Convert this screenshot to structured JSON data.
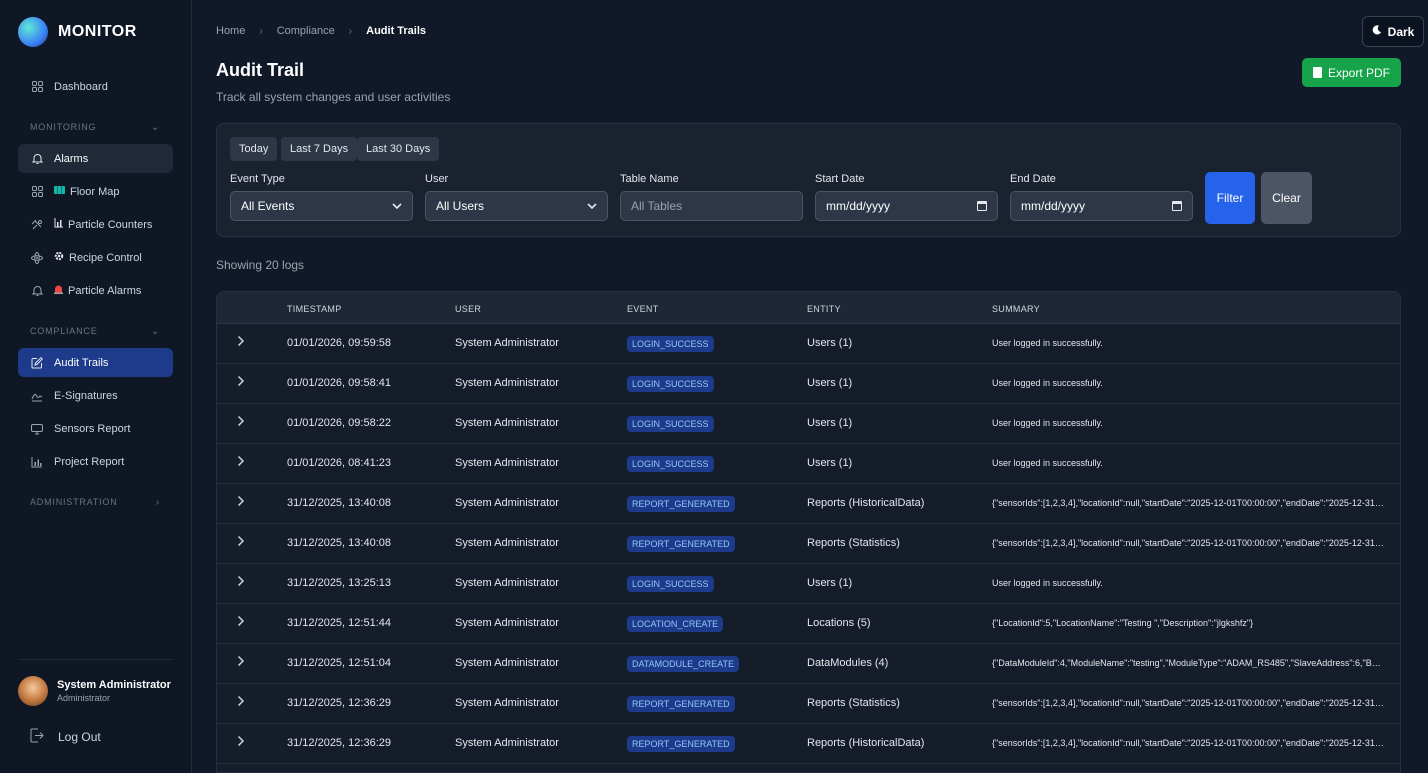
{
  "sidebar": {
    "brand": "MONITOR",
    "items": {
      "dashboard": "Dashboard",
      "alarms": "Alarms",
      "floor_map": "Floor Map",
      "particle_counters": "Particle Counters",
      "recipe_control": "Recipe Control",
      "particle_alarms": "Particle Alarms",
      "audit_trails": "Audit Trails",
      "e_signatures": "E-Signatures",
      "sensors_report": "Sensors Report",
      "project_report": "Project Report"
    },
    "sections": {
      "monitoring": "MONITORING",
      "compliance": "COMPLIANCE",
      "administration": "ADMINISTRATION"
    },
    "icons": {
      "dashboard": "grid-icon",
      "alarms": "bell-icon",
      "floor_map": "map-icon",
      "particle_counters": "chart-icon",
      "recipe_control": "gear-icon",
      "particle_alarms": "siren-icon",
      "audit_trails": "edit-icon",
      "e_signatures": "signature-icon",
      "sensors_report": "sensor-icon",
      "project_report": "bar-chart-icon"
    },
    "user": {
      "name": "System Administrator",
      "role": "Administrator"
    },
    "logout": "Log Out"
  },
  "breadcrumb": {
    "home": "Home",
    "compliance": "Compliance",
    "current": "Audit Trails"
  },
  "theme_toggle": "Dark",
  "page": {
    "title": "Audit Trail",
    "subtitle": "Track all system changes and user activities"
  },
  "export_label": "Export PDF",
  "filters": {
    "quick": [
      "Today",
      "Last 7 Days",
      "Last 30 Days"
    ],
    "event_type": {
      "label": "Event Type",
      "value": "All Events"
    },
    "user": {
      "label": "User",
      "value": "All Users"
    },
    "table_name": {
      "label": "Table Name",
      "placeholder": "All Tables"
    },
    "start_date": {
      "label": "Start Date",
      "value": "mm/dd/yyyy"
    },
    "end_date": {
      "label": "End Date",
      "value": "mm/dd/yyyy"
    },
    "filter_label": "Filter",
    "clear_label": "Clear"
  },
  "showing": "Showing 20 logs",
  "table": {
    "columns": [
      "TIMESTAMP",
      "USER",
      "EVENT",
      "ENTITY",
      "SUMMARY"
    ],
    "rows": [
      {
        "timestamp": "01/01/2026, 09:59:58",
        "user": "System Administrator",
        "event": "LOGIN_SUCCESS",
        "entity": "Users (1)",
        "summary": "User logged in successfully."
      },
      {
        "timestamp": "01/01/2026, 09:58:41",
        "user": "System Administrator",
        "event": "LOGIN_SUCCESS",
        "entity": "Users (1)",
        "summary": "User logged in successfully."
      },
      {
        "timestamp": "01/01/2026, 09:58:22",
        "user": "System Administrator",
        "event": "LOGIN_SUCCESS",
        "entity": "Users (1)",
        "summary": "User logged in successfully."
      },
      {
        "timestamp": "01/01/2026, 08:41:23",
        "user": "System Administrator",
        "event": "LOGIN_SUCCESS",
        "entity": "Users (1)",
        "summary": "User logged in successfully."
      },
      {
        "timestamp": "31/12/2025, 13:40:08",
        "user": "System Administrator",
        "event": "REPORT_GENERATED",
        "entity": "Reports (HistoricalData)",
        "summary": "{\"sensorIds\":[1,2,3,4],\"locationId\":null,\"startDate\":\"2025-12-01T00:00:00\",\"endDate\":\"2025-12-31T..."
      },
      {
        "timestamp": "31/12/2025, 13:40:08",
        "user": "System Administrator",
        "event": "REPORT_GENERATED",
        "entity": "Reports (Statistics)",
        "summary": "{\"sensorIds\":[1,2,3,4],\"locationId\":null,\"startDate\":\"2025-12-01T00:00:00\",\"endDate\":\"2025-12-31T..."
      },
      {
        "timestamp": "31/12/2025, 13:25:13",
        "user": "System Administrator",
        "event": "LOGIN_SUCCESS",
        "entity": "Users (1)",
        "summary": "User logged in successfully."
      },
      {
        "timestamp": "31/12/2025, 12:51:44",
        "user": "System Administrator",
        "event": "LOCATION_CREATE",
        "entity": "Locations (5)",
        "summary": "{\"LocationId\":5,\"LocationName\":\"Testing \",\"Description\":\"jlgkshfz\"}"
      },
      {
        "timestamp": "31/12/2025, 12:51:04",
        "user": "System Administrator",
        "event": "DATAMODULE_CREATE",
        "entity": "DataModules (4)",
        "summary": "{\"DataModuleId\":4,\"ModuleName\":\"testing\",\"ModuleType\":\"ADAM_RS485\",\"SlaveAddress\":6,\"Bas..."
      },
      {
        "timestamp": "31/12/2025, 12:36:29",
        "user": "System Administrator",
        "event": "REPORT_GENERATED",
        "entity": "Reports (Statistics)",
        "summary": "{\"sensorIds\":[1,2,3,4],\"locationId\":null,\"startDate\":\"2025-12-01T00:00:00\",\"endDate\":\"2025-12-31T..."
      },
      {
        "timestamp": "31/12/2025, 12:36:29",
        "user": "System Administrator",
        "event": "REPORT_GENERATED",
        "entity": "Reports (HistoricalData)",
        "summary": "{\"sensorIds\":[1,2,3,4],\"locationId\":null,\"startDate\":\"2025-12-01T00:00:00\",\"endDate\":\"2025-12-31T..."
      }
    ]
  },
  "colors": {
    "accent_blue": "#2563eb",
    "export_green": "#16a34a",
    "badge_bg": "#1e3a8a",
    "badge_text": "#93c5fd"
  }
}
